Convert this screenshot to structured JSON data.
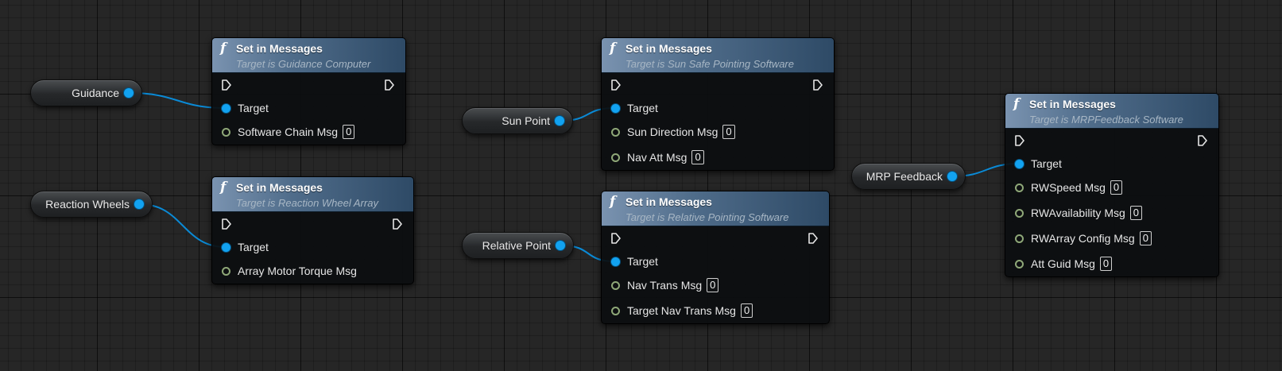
{
  "var_nodes": [
    {
      "id": "guidance",
      "label": "Guidance"
    },
    {
      "id": "reaction_wheels",
      "label": "Reaction Wheels"
    },
    {
      "id": "sun_point",
      "label": "Sun Point"
    },
    {
      "id": "relative_point",
      "label": "Relative Point"
    },
    {
      "id": "mrp_feedback",
      "label": "MRP Feedback"
    }
  ],
  "func_nodes": [
    {
      "id": "guidance_computer",
      "title": "Set in Messages",
      "subtitle": "Target is Guidance Computer",
      "pins": [
        {
          "label": "Target",
          "kind": "object"
        },
        {
          "label": "Software Chain Msg",
          "kind": "message",
          "value": "0"
        }
      ]
    },
    {
      "id": "reaction_wheel_array",
      "title": "Set in Messages",
      "subtitle": "Target is Reaction Wheel Array",
      "pins": [
        {
          "label": "Target",
          "kind": "object"
        },
        {
          "label": "Array Motor Torque Msg",
          "kind": "message"
        }
      ]
    },
    {
      "id": "sun_safe_pointing",
      "title": "Set in Messages",
      "subtitle": "Target is Sun Safe Pointing Software",
      "pins": [
        {
          "label": "Target",
          "kind": "object"
        },
        {
          "label": "Sun Direction Msg",
          "kind": "message",
          "value": "0"
        },
        {
          "label": "Nav Att Msg",
          "kind": "message",
          "value": "0"
        }
      ]
    },
    {
      "id": "relative_pointing",
      "title": "Set in Messages",
      "subtitle": "Target is Relative Pointing Software",
      "pins": [
        {
          "label": "Target",
          "kind": "object"
        },
        {
          "label": "Nav Trans Msg",
          "kind": "message",
          "value": "0"
        },
        {
          "label": "Target Nav Trans Msg",
          "kind": "message",
          "value": "0"
        }
      ]
    },
    {
      "id": "mrp_feedback_software",
      "title": "Set in Messages",
      "subtitle": "Target is MRPFeedback Software",
      "pins": [
        {
          "label": "Target",
          "kind": "object"
        },
        {
          "label": "RWSpeed Msg",
          "kind": "message",
          "value": "0"
        },
        {
          "label": "RWAvailability Msg",
          "kind": "message",
          "value": "0"
        },
        {
          "label": "RWArray Config Msg",
          "kind": "message",
          "value": "0"
        },
        {
          "label": "Att Guid Msg",
          "kind": "message",
          "value": "0"
        }
      ]
    }
  ],
  "connections": [
    {
      "from": "guidance",
      "to": "guidance_computer"
    },
    {
      "from": "reaction_wheels",
      "to": "reaction_wheel_array"
    },
    {
      "from": "sun_point",
      "to": "sun_safe_pointing"
    },
    {
      "from": "relative_point",
      "to": "relative_pointing"
    },
    {
      "from": "mrp_feedback",
      "to": "mrp_feedback_software"
    }
  ],
  "colors": {
    "background": "#262626",
    "wire": "#0a8ad6",
    "object_pin": "#12a2f0",
    "message_pin": "#8fa878",
    "header_start": "#7a93b0",
    "header_end": "#2e4a66"
  },
  "icons": {
    "function": "function-icon",
    "exec_in": "exec-in-icon",
    "exec_out": "exec-out-icon"
  }
}
